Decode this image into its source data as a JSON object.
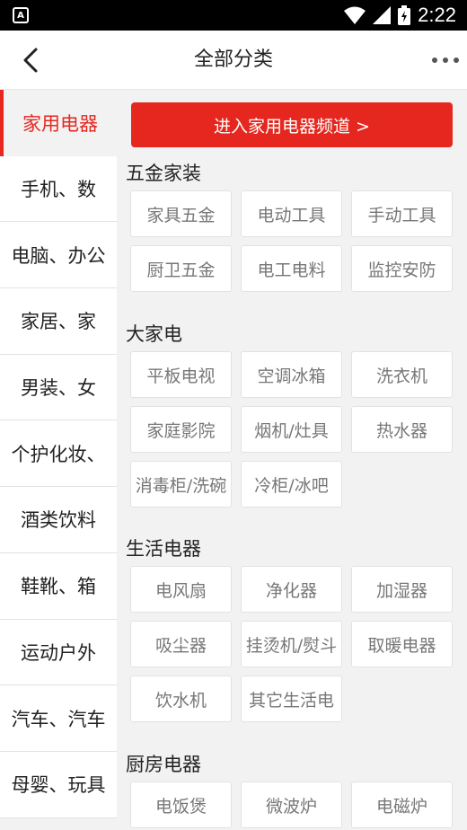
{
  "status_bar": {
    "time": "2:22",
    "app_icon": "A"
  },
  "nav": {
    "title": "全部分类"
  },
  "sidebar": {
    "items": [
      {
        "label": "家用电器",
        "active": true
      },
      {
        "label": "手机、数"
      },
      {
        "label": "电脑、办公"
      },
      {
        "label": "家居、家"
      },
      {
        "label": "男装、女"
      },
      {
        "label": "个护化妆、"
      },
      {
        "label": "酒类饮料"
      },
      {
        "label": "鞋靴、箱"
      },
      {
        "label": "运动户外"
      },
      {
        "label": "汽车、汽车"
      },
      {
        "label": "母婴、玩具"
      }
    ]
  },
  "content": {
    "enter_button": "进入家用电器频道 >",
    "sections": [
      {
        "title": "五金家装",
        "items": [
          "家具五金",
          "电动工具",
          "手动工具",
          "厨卫五金",
          "电工电料",
          "监控安防"
        ]
      },
      {
        "title": "大家电",
        "items": [
          "平板电视",
          "空调冰箱",
          "洗衣机",
          "家庭影院",
          "烟机/灶具",
          "热水器",
          "消毒柜/洗碗",
          "冷柜/冰吧"
        ]
      },
      {
        "title": "生活电器",
        "items": [
          "电风扇",
          "净化器",
          "加湿器",
          "吸尘器",
          "挂烫机/熨斗",
          "取暖电器",
          "饮水机",
          "其它生活电"
        ]
      },
      {
        "title": "厨房电器",
        "items": [
          "电饭煲",
          "微波炉",
          "电磁炉"
        ]
      }
    ]
  }
}
